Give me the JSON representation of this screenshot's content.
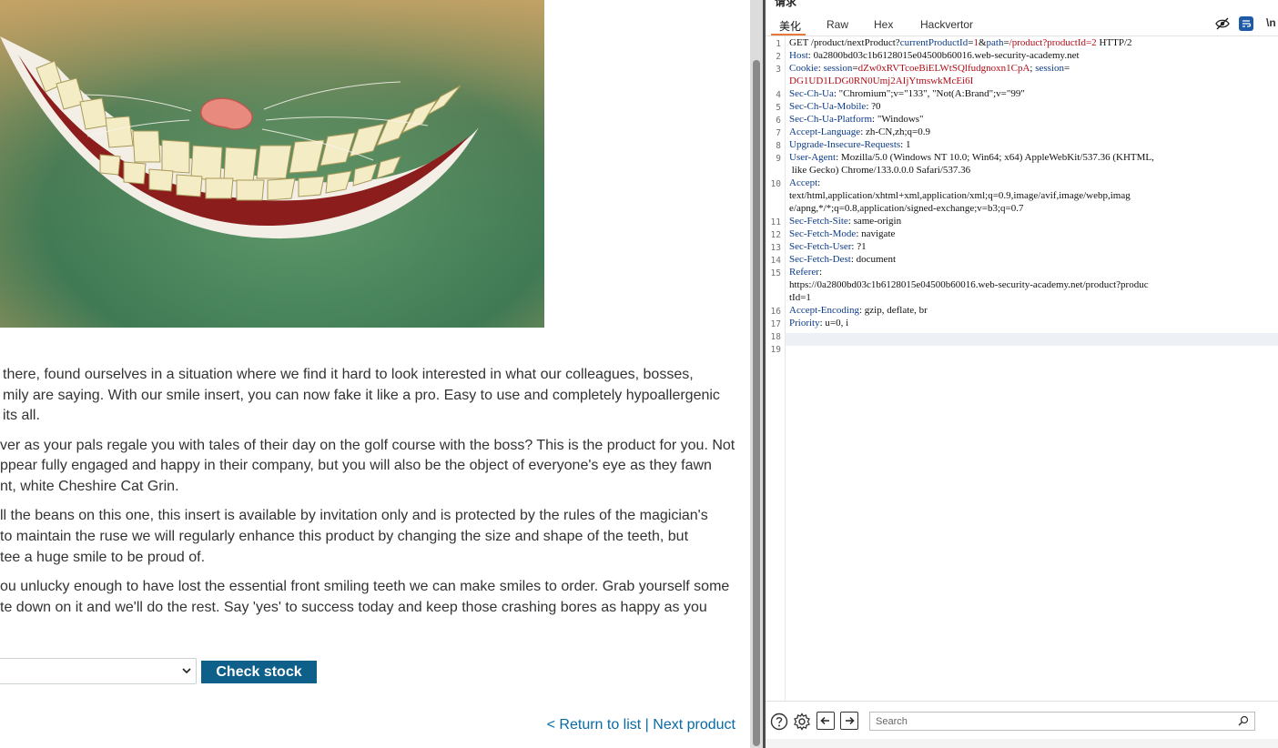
{
  "product": {
    "description": [
      [
        "there, found ourselves in a situation where we find it hard to look interested in what our colleagues, bosses,",
        "mily are saying. With our smile insert, you can now fake it like a pro. Easy to use and completely hypoallergenic",
        "its all."
      ],
      [
        "ver as your pals regale you with tales of their day on the golf course with the boss? This is the product for you. Not",
        "ppear fully engaged and happy in their company, but you will also be the object of everyone's eye as they fawn",
        "nt, white Cheshire Cat Grin."
      ],
      [
        "ll the beans on this one, this insert is available by invitation only and is protected by the rules of the magician's",
        "to maintain the ruse we will regularly enhance this product by changing the size and shape of the teeth, but",
        "tee a huge smile to be proud of."
      ],
      [
        "ou unlucky enough to have lost the essential front smiling teeth we can make smiles to order. Grab yourself some",
        "te down on it and we'll do the rest. Say 'yes' to success today and keep those crashing bores as happy as you"
      ]
    ],
    "check_stock_label": "Check stock",
    "return_link": "< Return to list",
    "separator": " | ",
    "next_link": "Next product"
  },
  "burp": {
    "title": "请求",
    "tabs": [
      "美化",
      "Raw",
      "Hex",
      "Hackvertor"
    ],
    "newline_toggle": "\\n",
    "line_numbers": [
      "1",
      "2",
      "3",
      "",
      "4",
      "5",
      "6",
      "7",
      "8",
      "9",
      "",
      "10",
      "",
      "",
      "11",
      "12",
      "13",
      "14",
      "15",
      "",
      "",
      "16",
      "17",
      "18",
      "19"
    ],
    "request_lines": [
      {
        "parts": [
          {
            "t": "GET /product/nextProduct?",
            "c": "n"
          },
          {
            "t": "currentProductId",
            "c": "k"
          },
          {
            "t": "=",
            "c": "n"
          },
          {
            "t": "1",
            "c": "rv"
          },
          {
            "t": "&",
            "c": "n"
          },
          {
            "t": "path",
            "c": "k"
          },
          {
            "t": "=",
            "c": "n"
          },
          {
            "t": "/product?productId=2",
            "c": "rv"
          },
          {
            "t": " HTTP/2",
            "c": "n"
          }
        ]
      },
      {
        "parts": [
          {
            "t": "Host",
            "c": "k"
          },
          {
            "t": ": 0a2800bd03c1b6128015e04500b60016.web-security-academy.net",
            "c": "n"
          }
        ]
      },
      {
        "parts": [
          {
            "t": "Cookie",
            "c": "k"
          },
          {
            "t": ": ",
            "c": "n"
          },
          {
            "t": "session",
            "c": "k"
          },
          {
            "t": "=",
            "c": "n"
          },
          {
            "t": "dZw0xRVTcoeBiELWtSQlfudgnoxn1CpA",
            "c": "rv"
          },
          {
            "t": "; ",
            "c": "n"
          },
          {
            "t": "session",
            "c": "k"
          },
          {
            "t": "=",
            "c": "n"
          }
        ]
      },
      {
        "parts": [
          {
            "t": "DG1UD1LDG0RN0Umj2AIjYtmswkMcEi6I",
            "c": "rv"
          }
        ]
      },
      {
        "parts": [
          {
            "t": "Sec-Ch-Ua",
            "c": "k"
          },
          {
            "t": ": \"Chromium\";v=\"133\", \"Not(A:Brand\";v=\"99\"",
            "c": "n"
          }
        ]
      },
      {
        "parts": [
          {
            "t": "Sec-Ch-Ua-Mobile",
            "c": "k"
          },
          {
            "t": ": ?0",
            "c": "n"
          }
        ]
      },
      {
        "parts": [
          {
            "t": "Sec-Ch-Ua-Platform",
            "c": "k"
          },
          {
            "t": ": \"Windows\"",
            "c": "n"
          }
        ]
      },
      {
        "parts": [
          {
            "t": "Accept-Language",
            "c": "k"
          },
          {
            "t": ": zh-CN,zh;q=0.9",
            "c": "n"
          }
        ]
      },
      {
        "parts": [
          {
            "t": "Upgrade-Insecure-Requests",
            "c": "k"
          },
          {
            "t": ": 1",
            "c": "n"
          }
        ]
      },
      {
        "parts": [
          {
            "t": "User-Agent",
            "c": "k"
          },
          {
            "t": ": Mozilla/5.0 (Windows NT 10.0; Win64; x64) AppleWebKit/537.36 (KHTML,",
            "c": "n"
          }
        ]
      },
      {
        "parts": [
          {
            "t": " like Gecko) Chrome/133.0.0.0 Safari/537.36",
            "c": "n"
          }
        ]
      },
      {
        "parts": [
          {
            "t": "Accept",
            "c": "k"
          },
          {
            "t": ":",
            "c": "n"
          }
        ]
      },
      {
        "parts": [
          {
            "t": "text/html,application/xhtml+xml,application/xml;q=0.9,image/avif,image/webp,imag",
            "c": "n"
          }
        ]
      },
      {
        "parts": [
          {
            "t": "e/apng,*/*;q=0.8,application/signed-exchange;v=b3;q=0.7",
            "c": "n"
          }
        ]
      },
      {
        "parts": [
          {
            "t": "Sec-Fetch-Site",
            "c": "k"
          },
          {
            "t": ": same-origin",
            "c": "n"
          }
        ]
      },
      {
        "parts": [
          {
            "t": "Sec-Fetch-Mode",
            "c": "k"
          },
          {
            "t": ": navigate",
            "c": "n"
          }
        ]
      },
      {
        "parts": [
          {
            "t": "Sec-Fetch-User",
            "c": "k"
          },
          {
            "t": ": ?1",
            "c": "n"
          }
        ]
      },
      {
        "parts": [
          {
            "t": "Sec-Fetch-Dest",
            "c": "k"
          },
          {
            "t": ": document",
            "c": "n"
          }
        ]
      },
      {
        "parts": [
          {
            "t": "Referer",
            "c": "k"
          },
          {
            "t": ":",
            "c": "n"
          }
        ]
      },
      {
        "parts": [
          {
            "t": "https://0a2800bd03c1b6128015e04500b60016.web-security-academy.net/product?produc",
            "c": "n"
          }
        ]
      },
      {
        "parts": [
          {
            "t": "tId=1",
            "c": "n"
          }
        ]
      },
      {
        "parts": [
          {
            "t": "Accept-Encoding",
            "c": "k"
          },
          {
            "t": ": gzip, deflate, br",
            "c": "n"
          }
        ]
      },
      {
        "parts": [
          {
            "t": "Priority",
            "c": "k"
          },
          {
            "t": ": u=0, i",
            "c": "n"
          }
        ]
      },
      {
        "parts": []
      },
      {
        "parts": []
      }
    ],
    "search_placeholder": "Search"
  },
  "colors": {
    "button": "#0e5f89",
    "link": "#0a6aa7",
    "header_key": "#0c3b88",
    "param_value": "#b00d17",
    "active_tab": "#e8773b"
  },
  "icons": [
    "product-image-smile",
    "chevron-down-icon",
    "hide-icon",
    "wrap-icon",
    "help-icon",
    "gear-icon",
    "arrow-left-icon",
    "arrow-right-icon",
    "search-icon"
  ]
}
